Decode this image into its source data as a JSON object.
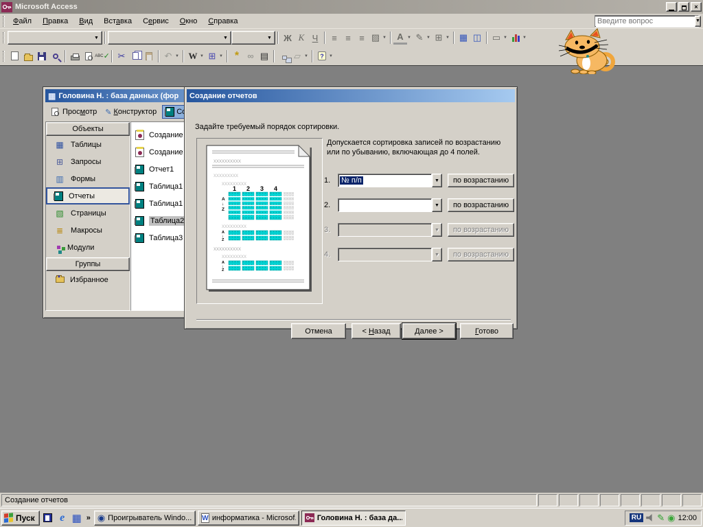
{
  "app": {
    "title": "Microsoft Access",
    "question_placeholder": "Введите вопрос"
  },
  "menu": {
    "items": [
      {
        "pre": "",
        "key": "Ф",
        "post": "айл"
      },
      {
        "pre": "",
        "key": "П",
        "post": "равка"
      },
      {
        "pre": "",
        "key": "В",
        "post": "ид"
      },
      {
        "pre": "Вст",
        "key": "а",
        "post": "вка"
      },
      {
        "pre": "С",
        "key": "е",
        "post": "рвис"
      },
      {
        "pre": "",
        "key": "О",
        "post": "кно"
      },
      {
        "pre": "",
        "key": "С",
        "post": "правка"
      }
    ]
  },
  "icons": {
    "bold": "Ж",
    "italic": "К",
    "underline": "Ч",
    "align": "≡",
    "fill": "▨",
    "font_color": "А",
    "line_color": "✎",
    "borders": "⊞",
    "datasheet": "▦",
    "column": "◫",
    "flat_box": "▭",
    "cut": "✂",
    "undo": "↶",
    "office_links": "W",
    "analyze": "⊞",
    "wand": "*",
    "infinity": "∞",
    "properties": "▤",
    "new_object": "▱",
    "spell_abc": "ABC",
    "spell_check": "✓",
    "help": "?",
    "dropdown": "▼",
    "chevron": "»",
    "ie": "e",
    "grid": "▦",
    "wmp": "◉",
    "tables": "▦",
    "queries": "⊞",
    "forms": "▥",
    "pages": "▧",
    "macros": "≣",
    "star": "*",
    "pencil": "✎",
    "circle": "◉",
    "dbicon": "▦"
  },
  "db_window": {
    "title": "Головина Н. : база данных (фор",
    "toolbar": {
      "preview": {
        "pre": "Прос",
        "key": "м",
        "post": "отр"
      },
      "design": {
        "pre": "",
        "key": "К",
        "post": "онструктор"
      },
      "new_visible": "Со"
    },
    "sidebar": {
      "objects_header": "Объекты",
      "items": [
        "Таблицы",
        "Запросы",
        "Формы",
        "Отчеты",
        "Страницы",
        "Макросы",
        "Модули"
      ],
      "groups_header": "Группы",
      "favorites": "Избранное"
    },
    "list": [
      "Создание",
      "Создание",
      "Отчет1",
      "Таблица1",
      "Таблица1",
      "Таблица2",
      "Таблица3"
    ]
  },
  "wizard": {
    "title": "Создание отчетов",
    "instruction": "Задайте требуемый порядок сортировки.",
    "description": "Допускается сортировка записей по возрастанию или по убыванию, включающая до 4 полей.",
    "rows": [
      {
        "num": "1.",
        "value": "№ п/п",
        "button": "по возрастанию"
      },
      {
        "num": "2.",
        "value": "",
        "button": "по возрастанию"
      },
      {
        "num": "3.",
        "value": "",
        "button": "по возрастанию"
      },
      {
        "num": "4.",
        "value": "",
        "button": "по возрастанию"
      }
    ],
    "preview": {
      "cols": [
        "1",
        "2",
        "3",
        "4"
      ],
      "x10": "xxxxxxxxxx",
      "x9": "xxxxxxxxx",
      "sort_top": "A",
      "sort_arrow": "↓",
      "sort_bottom": "Z"
    },
    "buttons": {
      "cancel": "Отмена",
      "back": {
        "pre": "< ",
        "key": "Н",
        "post": "азад"
      },
      "next": {
        "pre": "",
        "key": "Д",
        "post": "алее >"
      },
      "finish": {
        "pre": "",
        "key": "Г",
        "post": "отово"
      }
    }
  },
  "statusbar": {
    "text": "Создание отчетов"
  },
  "taskbar": {
    "start": "Пуск",
    "tasks": [
      {
        "label": "Проигрыватель Windo..."
      },
      {
        "label": "информатика - Microsof..."
      },
      {
        "label": "Головина Н. : база да..."
      }
    ],
    "tray": {
      "lang": "RU",
      "clock": "12:00"
    }
  },
  "colors": {
    "title_gradient_start": "#26569e",
    "title_gradient_end": "#a6caf0",
    "cyan": "#00dede",
    "teal": "#008080",
    "chrome": "#d4d0c8",
    "workspace": "#808080",
    "selection": "#0a246a"
  }
}
